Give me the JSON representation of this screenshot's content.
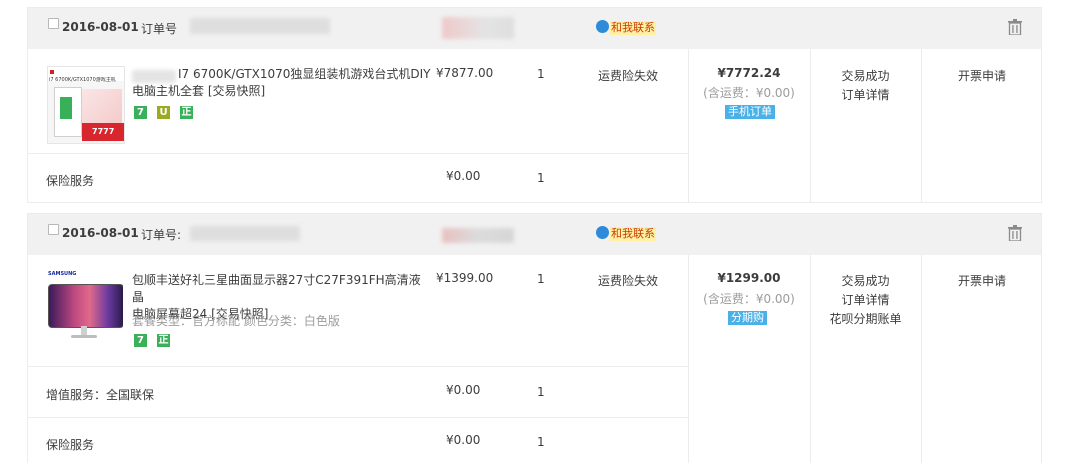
{
  "orders": [
    {
      "date": "2016-08-01",
      "order_no_label": "订单号",
      "contact_label": "和我联系",
      "product": {
        "title_line1": "I7 6700K/GTX1070独显组装机游戏台式机DIY",
        "title_line2": "电脑主机全套 [交易快照]",
        "thumb_text": "i7 6700K/GTX1070游戏主机",
        "thumb_price": "7777",
        "price": "¥7877.00",
        "qty": "1",
        "service": "运费险失效",
        "badges": [
          "7",
          "U",
          "正"
        ]
      },
      "total": "¥7772.24",
      "shipping": "(含运费：¥0.00)",
      "order_type": "手机订单",
      "status": "交易成功",
      "detail": "订单详情",
      "invoice": "开票申请",
      "extras": [
        {
          "label": "保险服务",
          "price": "¥0.00",
          "qty": "1"
        }
      ]
    },
    {
      "date": "2016-08-01",
      "order_no_label": "订单号:",
      "contact_label": "和我联系",
      "product": {
        "title_line1": "包顺丰送好礼三星曲面显示器27寸C27F391FH高清液晶",
        "title_line2": "电脑屏幕超24 [交易快照]",
        "spec": "套餐类型：官方标配  颜色分类：白色版",
        "brand": "SAMSUNG",
        "price": "¥1399.00",
        "qty": "1",
        "service": "运费险失效",
        "badges": [
          "7",
          "正"
        ]
      },
      "total": "¥1299.00",
      "shipping": "(含运费：¥0.00)",
      "order_type": "分期购",
      "status": "交易成功",
      "detail": "订单详情",
      "extra_link": "花呗分期账单",
      "invoice": "开票申请",
      "extras": [
        {
          "label": "增值服务：全国联保",
          "price": "¥0.00",
          "qty": "1"
        },
        {
          "label": "保险服务",
          "price": "¥0.00",
          "qty": "1"
        }
      ]
    }
  ],
  "colors": {
    "header_bg": "#f1f1f1",
    "border": "#ececec",
    "contact_bg": "#fff0a5",
    "contact_text": "#c83c00",
    "tag_blue": "#4ab0e8",
    "badge_green": "#3ab05a"
  },
  "icons": [
    "checkbox-icon",
    "wangwang-icon",
    "trash-icon"
  ]
}
